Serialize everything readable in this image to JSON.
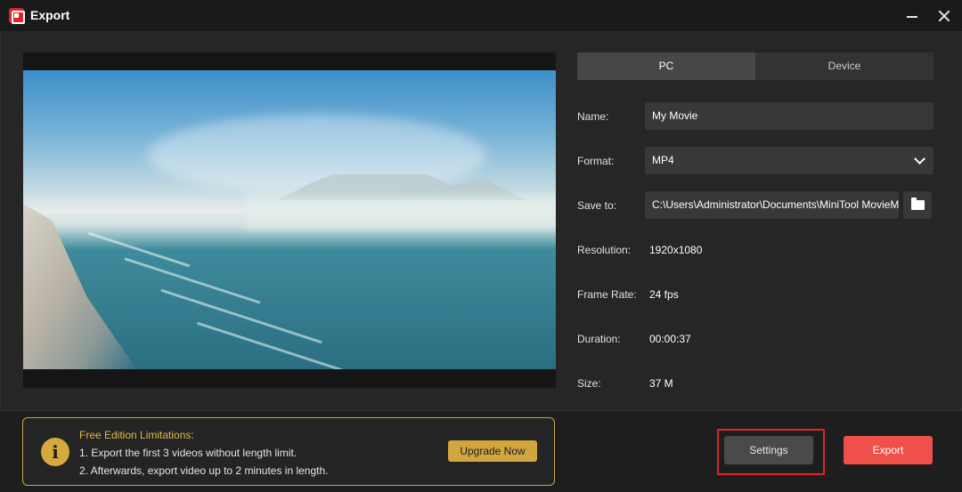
{
  "window": {
    "title": "Export"
  },
  "tabs": [
    {
      "label": "PC"
    },
    {
      "label": "Device"
    }
  ],
  "fields": {
    "name": {
      "label": "Name:",
      "value": "My Movie"
    },
    "format": {
      "label": "Format:",
      "value": "MP4"
    },
    "save_to": {
      "label": "Save to:",
      "value": "C:\\Users\\Administrator\\Documents\\MiniTool MovieMaker\\output"
    },
    "resolution": {
      "label": "Resolution:",
      "value": "1920x1080"
    },
    "frame_rate": {
      "label": "Frame Rate:",
      "value": "24 fps"
    },
    "duration": {
      "label": "Duration:",
      "value": "00:00:37"
    },
    "size": {
      "label": "Size:",
      "value": "37 M"
    }
  },
  "limitations": {
    "title": "Free Edition Limitations:",
    "lines": [
      "1. Export the first 3 videos without length limit.",
      "2. Afterwards, export video up to 2 minutes in length."
    ],
    "upgrade_label": "Upgrade Now",
    "info_glyph": "i"
  },
  "actions": {
    "settings_label": "Settings",
    "export_label": "Export"
  },
  "colors": {
    "accent_red": "#f0504a",
    "gold": "#d1a63f",
    "highlight": "#e0242a"
  }
}
